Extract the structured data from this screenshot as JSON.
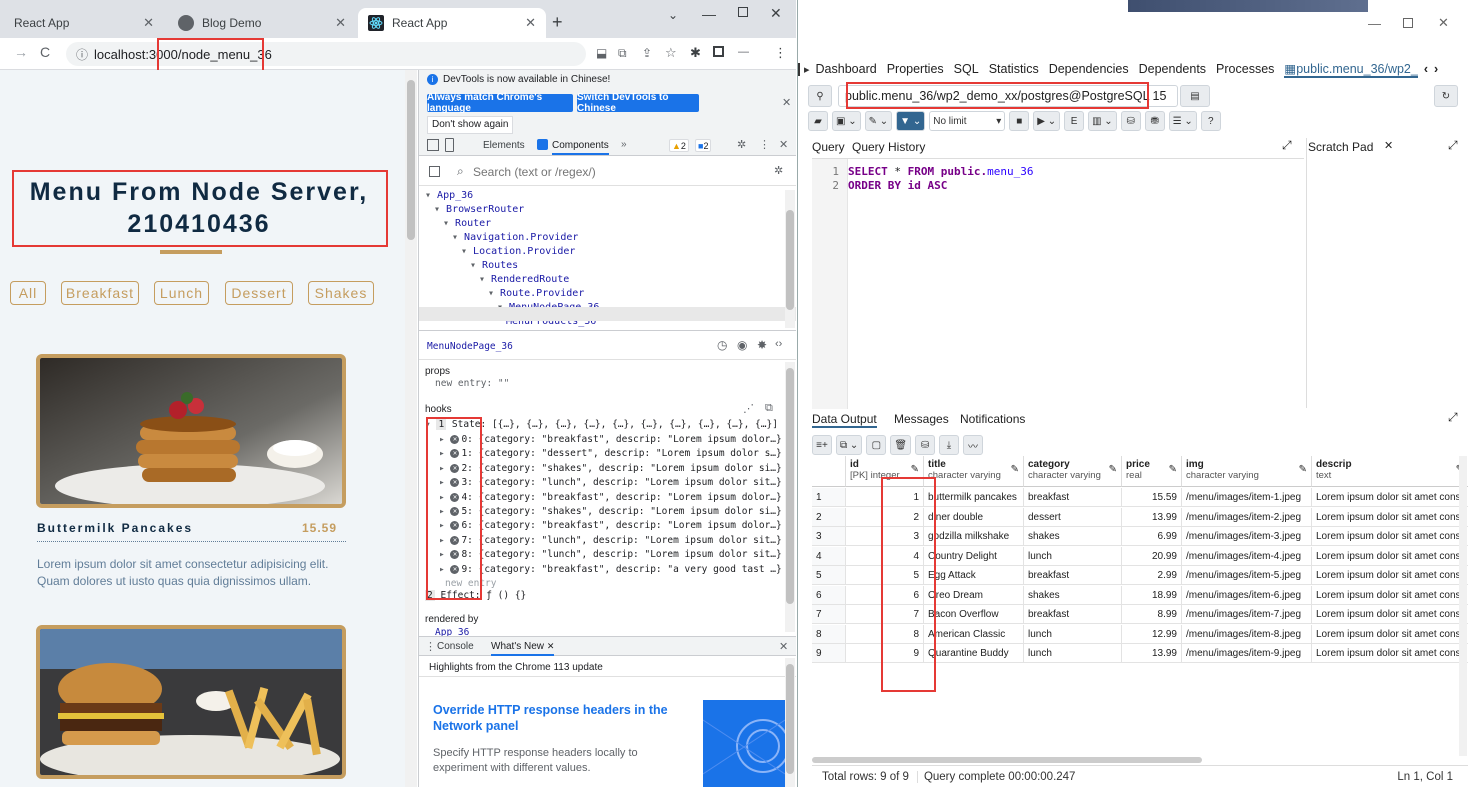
{
  "chrome": {
    "tabs": [
      {
        "label": "React App"
      },
      {
        "label": "Blog Demo"
      },
      {
        "label": "React App"
      }
    ],
    "url": "localhost:3000/node_menu_36"
  },
  "page": {
    "title_line1": "Menu From Node Server,",
    "title_line2": "210410436",
    "filters": [
      "All",
      "Breakfast",
      "Lunch",
      "Dessert",
      "Shakes"
    ],
    "item": {
      "title": "Buttermilk Pancakes",
      "price": "15.59",
      "desc": "Lorem ipsum dolor sit amet consectetur adipisicing elit. Quam dolores ut iusto quas quia dignissimos ullam."
    }
  },
  "devtools": {
    "notice": "DevTools is now available in Chinese!",
    "btn_match": "Always match Chrome's language",
    "btn_switch": "Switch DevTools to Chinese",
    "btn_dont_show": "Don't show again",
    "tab_elements": "Elements",
    "tab_components": "Components",
    "warn_count": "2",
    "msg_count": "2",
    "search_placeholder": "Search (text or /regex/)",
    "tree": [
      {
        "label": "App_36",
        "indent": 0
      },
      {
        "label": "BrowserRouter",
        "indent": 1
      },
      {
        "label": "Router",
        "indent": 2
      },
      {
        "label": "Navigation.Provider",
        "indent": 3
      },
      {
        "label": "Location.Provider",
        "indent": 4
      },
      {
        "label": "Routes",
        "indent": 5
      },
      {
        "label": "RenderedRoute",
        "indent": 6
      },
      {
        "label": "Route.Provider",
        "indent": 7
      },
      {
        "label": "MenuNodePage_36",
        "indent": 8
      },
      {
        "label": "MenuProducts_36",
        "indent": 9
      }
    ],
    "selected_component": "MenuNodePage_36",
    "props_label": "props",
    "props_entry": "new entry: \"\"",
    "hooks_label": "hooks",
    "state_line": "State: [{…}, {…}, {…}, {…}, {…}, {…}, {…}, {…}, {…}, {…}]",
    "hooks": [
      "0: {category: \"breakfast\", descrip: \"Lorem ipsum dolor…}",
      "1: {category: \"dessert\", descrip: \"Lorem ipsum dolor s…}",
      "2: {category: \"shakes\", descrip: \"Lorem ipsum dolor si…}",
      "3: {category: \"lunch\", descrip: \"Lorem ipsum dolor sit…}",
      "4: {category: \"breakfast\", descrip: \"Lorem ipsum dolor…}",
      "5: {category: \"shakes\", descrip: \"Lorem ipsum dolor si…}",
      "6: {category: \"breakfast\", descrip: \"Lorem ipsum dolor…}",
      "7: {category: \"lunch\", descrip: \"Lorem ipsum dolor sit…}",
      "8: {category: \"lunch\", descrip: \"Lorem ipsum dolor sit…}",
      "9: {category: \"breakfast\", descrip: \"a very good tast …}"
    ],
    "new_entry": "new entry",
    "effect_line": "Effect: ƒ () {}",
    "rendered_by": "rendered by",
    "rendered_by_value": "App_36",
    "console_tab": "Console",
    "whats_new_tab": "What's New",
    "highlights": "Highlights from the Chrome 113 update",
    "feature_title": "Override HTTP response headers in the Network panel",
    "feature_desc": "Specify HTTP response headers locally to experiment with different values."
  },
  "pgadmin": {
    "tabs": [
      "Dashboard",
      "Properties",
      "SQL",
      "Statistics",
      "Dependencies",
      "Dependents",
      "Processes"
    ],
    "active_tab": "public.menu_36/wp2_",
    "connection": "public.menu_36/wp2_demo_xx/postgres@PostgreSQL 15",
    "limit": "No limit",
    "query_tab": "Query",
    "history_tab": "Query History",
    "scratch_tab": "Scratch Pad",
    "sql_line1": {
      "kw1": "SELECT",
      "mid": " * ",
      "kw2": "FROM",
      "rest": " public.",
      "id": "menu_36"
    },
    "sql_line2": {
      "kw1": "ORDER BY",
      "rest": " id ",
      "kw2": "ASC"
    },
    "out_tabs": [
      "Data Output",
      "Messages",
      "Notifications"
    ],
    "columns": [
      {
        "name": "id",
        "type": "[PK] integer"
      },
      {
        "name": "title",
        "type": "character varying"
      },
      {
        "name": "category",
        "type": "character varying"
      },
      {
        "name": "price",
        "type": "real"
      },
      {
        "name": "img",
        "type": "character varying"
      },
      {
        "name": "descrip",
        "type": "text"
      }
    ],
    "rows": [
      [
        "1",
        "1",
        "buttermilk pancakes",
        "breakfast",
        "15.59",
        "/menu/images/item-1.jpeg",
        "Lorem ipsum dolor sit amet cons"
      ],
      [
        "2",
        "2",
        "diner double",
        "dessert",
        "13.99",
        "/menu/images/item-2.jpeg",
        "Lorem ipsum dolor sit amet cons"
      ],
      [
        "3",
        "3",
        "godzilla milkshake",
        "shakes",
        "6.99",
        "/menu/images/item-3.jpeg",
        "Lorem ipsum dolor sit amet cons"
      ],
      [
        "4",
        "4",
        "Country Delight",
        "lunch",
        "20.99",
        "/menu/images/item-4.jpeg",
        "Lorem ipsum dolor sit amet cons"
      ],
      [
        "5",
        "5",
        "Egg Attack",
        "breakfast",
        "2.99",
        "/menu/images/item-5.jpeg",
        "Lorem ipsum dolor sit amet cons"
      ],
      [
        "6",
        "6",
        "Oreo Dream",
        "shakes",
        "18.99",
        "/menu/images/item-6.jpeg",
        "Lorem ipsum dolor sit amet cons"
      ],
      [
        "7",
        "7",
        "Bacon Overflow",
        "breakfast",
        "8.99",
        "/menu/images/item-7.jpeg",
        "Lorem ipsum dolor sit amet cons"
      ],
      [
        "8",
        "8",
        "American Classic",
        "lunch",
        "12.99",
        "/menu/images/item-8.jpeg",
        "Lorem ipsum dolor sit amet cons"
      ],
      [
        "9",
        "9",
        "Quarantine Buddy",
        "lunch",
        "13.99",
        "/menu/images/item-9.jpeg",
        "Lorem ipsum dolor sit amet cons"
      ]
    ],
    "total_rows": "Total rows: 9 of 9",
    "query_complete": "Query complete 00:00:00.247",
    "cursor_pos": "Ln 1, Col 1"
  },
  "colors": {
    "accent_gold": "#c59d5f",
    "heading_navy": "#102a42",
    "chrome_blue": "#1a73e8",
    "highlight_red": "#e53935"
  }
}
